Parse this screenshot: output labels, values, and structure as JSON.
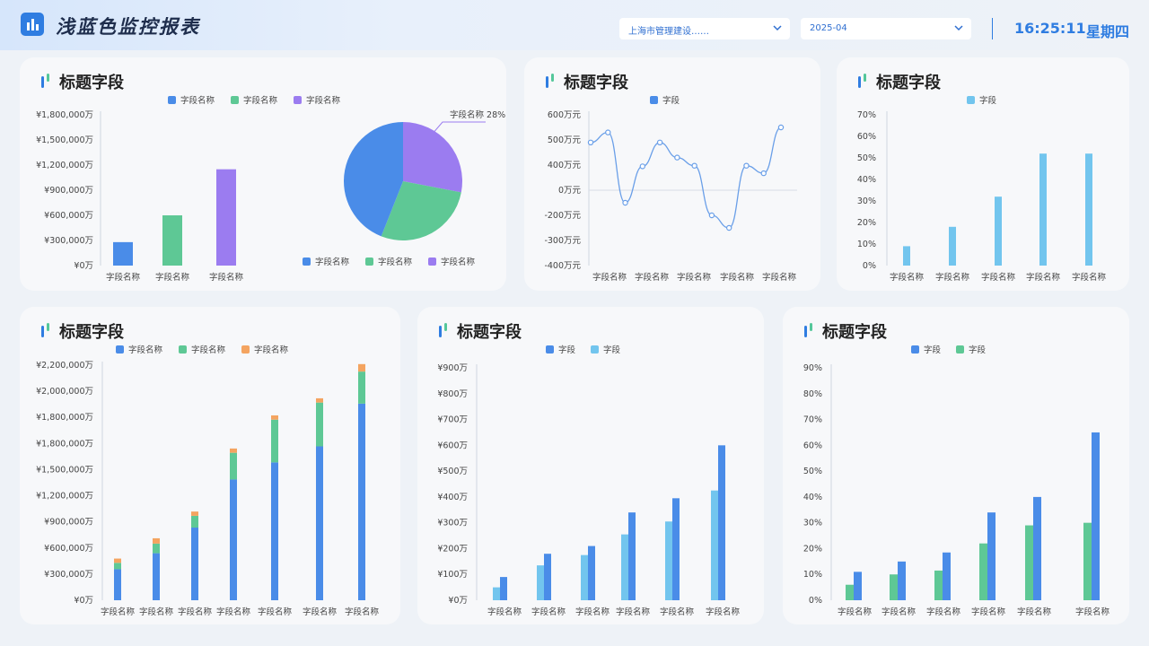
{
  "header": {
    "title": "浅蓝色监控报表",
    "region_select": "上海市管理建设……",
    "date_select": "2025-04",
    "time": "16:25:11",
    "weekday": "星期四"
  },
  "colors": {
    "blue": "#4a8ce8",
    "green": "#5ec895",
    "purple": "#9b7cf0",
    "light_blue": "#72c5ee",
    "orange": "#f4a460"
  },
  "panels": {
    "p1": {
      "title": "标题字段"
    },
    "p2": {
      "title": "标题字段"
    },
    "p3": {
      "title": "标题字段"
    },
    "p4": {
      "title": "标题字段"
    },
    "p5": {
      "title": "标题字段"
    },
    "p6": {
      "title": "标题字段"
    }
  },
  "chart_data": [
    {
      "type": "bar",
      "legend": [
        "字段名称",
        "字段名称",
        "字段名称"
      ],
      "categories": [
        "字段名称",
        "字段名称",
        "字段名称"
      ],
      "values": [
        280000,
        600000,
        1150000
      ],
      "colors": [
        "#4a8ce8",
        "#5ec895",
        "#9b7cf0"
      ],
      "ylim": [
        0,
        1800000
      ],
      "yticks": [
        "¥0万",
        "¥300,000万",
        "¥600,000万",
        "¥900,000万",
        "¥1,200,000万",
        "¥1,500,000万",
        "¥1,800,000万"
      ]
    },
    {
      "type": "pie",
      "legend": [
        "字段名称",
        "字段名称",
        "字段名称"
      ],
      "slices": [
        {
          "name": "字段名称",
          "value": 44,
          "color": "#4a8ce8"
        },
        {
          "name": "字段名称",
          "value": 28,
          "color": "#5ec895"
        },
        {
          "name": "字段名称",
          "value": 28,
          "color": "#9b7cf0"
        }
      ],
      "callout": "字段名称  28%"
    },
    {
      "type": "line",
      "legend": [
        "字段"
      ],
      "categories": [
        "字段名称",
        "字段名称",
        "字段名称",
        "字段名称",
        "字段名称"
      ],
      "values": [
        490,
        530,
        -100,
        380,
        490,
        430,
        390,
        -200,
        -250,
        390,
        270,
        550
      ],
      "ylim": [
        -400,
        600
      ],
      "yticks": [
        "-400万元",
        "-300万元",
        "-200万元",
        "0万元",
        "400万元",
        "500万元",
        "600万元"
      ]
    },
    {
      "type": "bar",
      "legend": [
        "字段"
      ],
      "categories": [
        "字段名称",
        "字段名称",
        "字段名称",
        "字段名称",
        "字段名称"
      ],
      "values": [
        9,
        18,
        32,
        52,
        52
      ],
      "ylim": [
        0,
        70
      ],
      "yticks": [
        "0%",
        "10%",
        "20%",
        "30%",
        "40%",
        "50%",
        "60%",
        "70%"
      ]
    },
    {
      "type": "bar",
      "stacked": true,
      "legend": [
        "字段名称",
        "字段名称",
        "字段名称"
      ],
      "categories": [
        "字段名称",
        "字段名称",
        "字段名称",
        "字段名称",
        "字段名称",
        "字段名称",
        "字段名称"
      ],
      "series": [
        {
          "name": "字段名称",
          "values": [
            290000,
            440000,
            680000,
            1130000,
            1290000,
            1440000,
            1840000
          ]
        },
        {
          "name": "字段名称",
          "values": [
            60000,
            90000,
            110000,
            250000,
            400000,
            410000,
            300000
          ]
        },
        {
          "name": "字段名称",
          "values": [
            40000,
            50000,
            40000,
            40000,
            40000,
            40000,
            70000
          ]
        }
      ],
      "ylim": [
        0,
        2200000
      ],
      "yticks": [
        "¥0万",
        "¥300,000万",
        "¥600,000万",
        "¥900,000万",
        "¥1,200,000万",
        "¥1,500,000万",
        "¥1,800,000万",
        "¥1,800,000万",
        "¥2,000,000万",
        "¥2,200,000万"
      ]
    },
    {
      "type": "bar",
      "legend": [
        "字段",
        "字段"
      ],
      "categories": [
        "字段名称",
        "字段名称",
        "字段名称",
        "字段名称",
        "字段名称",
        "字段名称"
      ],
      "series": [
        {
          "name": "字段",
          "values": [
            50,
            135,
            175,
            255,
            305,
            425
          ]
        },
        {
          "name": "字段",
          "values": [
            90,
            180,
            210,
            340,
            395,
            600
          ]
        }
      ],
      "ylim": [
        0,
        900
      ],
      "yticks": [
        "¥0万",
        "¥100万",
        "¥200万",
        "¥300万",
        "¥400万",
        "¥500万",
        "¥600万",
        "¥700万",
        "¥800万",
        "¥900万"
      ]
    },
    {
      "type": "bar",
      "legend": [
        "字段",
        "字段"
      ],
      "categories": [
        "字段名称",
        "字段名称",
        "字段名称",
        "字段名称",
        "字段名称",
        "字段名称"
      ],
      "series": [
        {
          "name": "字段",
          "values": [
            6,
            10,
            11.5,
            22,
            29,
            30
          ]
        },
        {
          "name": "字段",
          "values": [
            11,
            15,
            18.5,
            34,
            40,
            65
          ]
        }
      ],
      "ylim": [
        0,
        90
      ],
      "yticks": [
        "0%",
        "10%",
        "20%",
        "30%",
        "40%",
        "50%",
        "60%",
        "70%",
        "80%",
        "90%"
      ]
    }
  ]
}
